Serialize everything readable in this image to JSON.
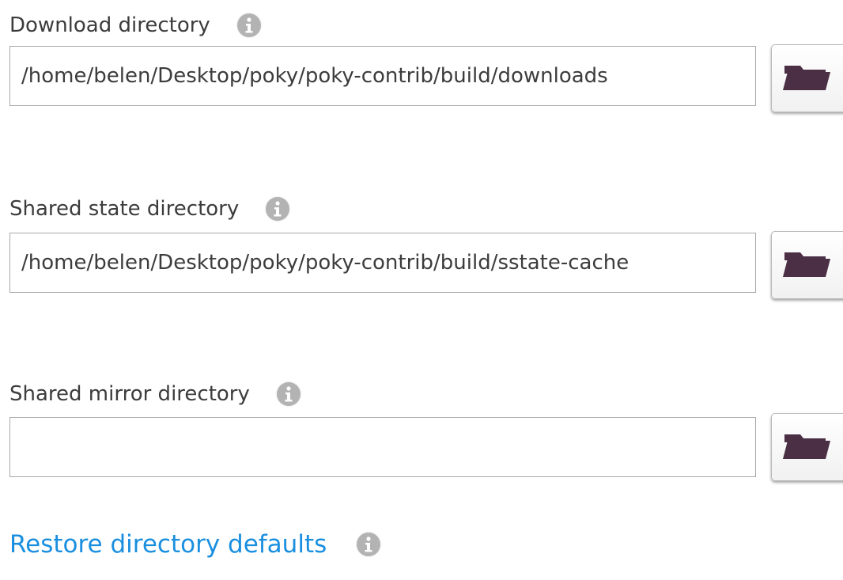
{
  "download": {
    "label": "Download directory",
    "value": "/home/belen/Desktop/poky/poky-contrib/build/downloads",
    "placeholder": ""
  },
  "sstate": {
    "label": "Shared state directory",
    "value": "/home/belen/Desktop/poky/poky-contrib/build/sstate-cache",
    "placeholder": ""
  },
  "mirror": {
    "label": "Shared mirror directory",
    "value": "",
    "placeholder": ""
  },
  "restore": {
    "label": "Restore directory defaults"
  },
  "icons": {
    "info": "info-icon",
    "folder": "folder-open-icon"
  },
  "colors": {
    "link": "#1a8fe0",
    "info_badge": "#b3b3b3",
    "folder": "#4a2f45"
  }
}
